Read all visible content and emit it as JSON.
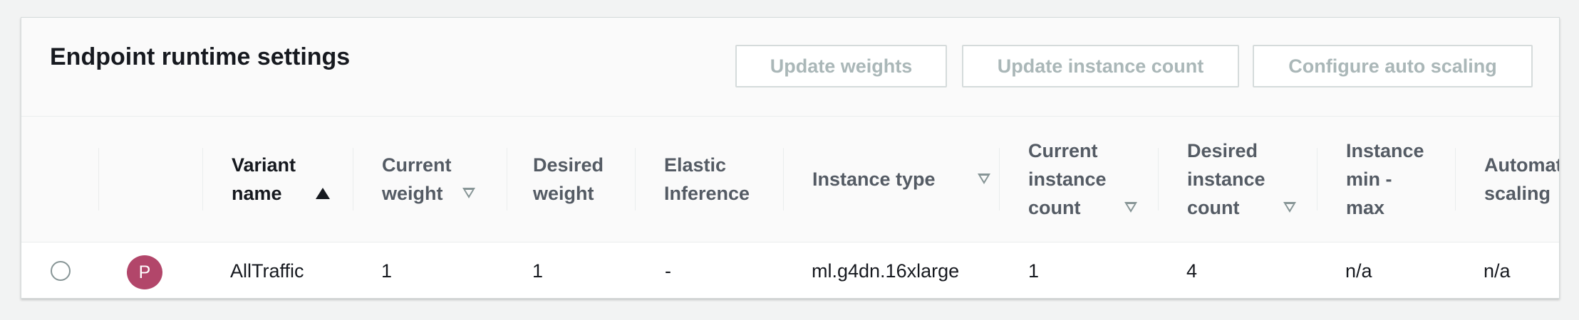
{
  "panel": {
    "title": "Endpoint runtime settings",
    "buttons": {
      "update_weights": "Update weights",
      "update_instance_count": "Update instance count",
      "configure_auto_scaling": "Configure auto scaling"
    }
  },
  "table": {
    "columns": {
      "variant_name": "Variant\nname",
      "current_weight": "Current\nweight",
      "desired_weight": "Desired\nweight",
      "elastic_inference": "Elastic\nInference",
      "instance_type": "Instance type",
      "current_instance_count": "Current\ninstance\ncount",
      "desired_instance_count": "Desired\ninstance\ncount",
      "instance_min_max": "Instance\nmin -\nmax",
      "automatic_scaling": "Automat\nscaling"
    },
    "sort": {
      "active_column": "variant_name",
      "direction": "ascending"
    },
    "rows": [
      {
        "selected": false,
        "avatar_letter": "P",
        "avatar_color": "#b2466a",
        "variant_name": "AllTraffic",
        "current_weight": "1",
        "desired_weight": "1",
        "elastic_inference": "-",
        "instance_type": "ml.g4dn.16xlarge",
        "current_instance_count": "1",
        "desired_instance_count": "4",
        "instance_min_max": "n/a",
        "automatic_scaling": "n/a"
      }
    ]
  }
}
